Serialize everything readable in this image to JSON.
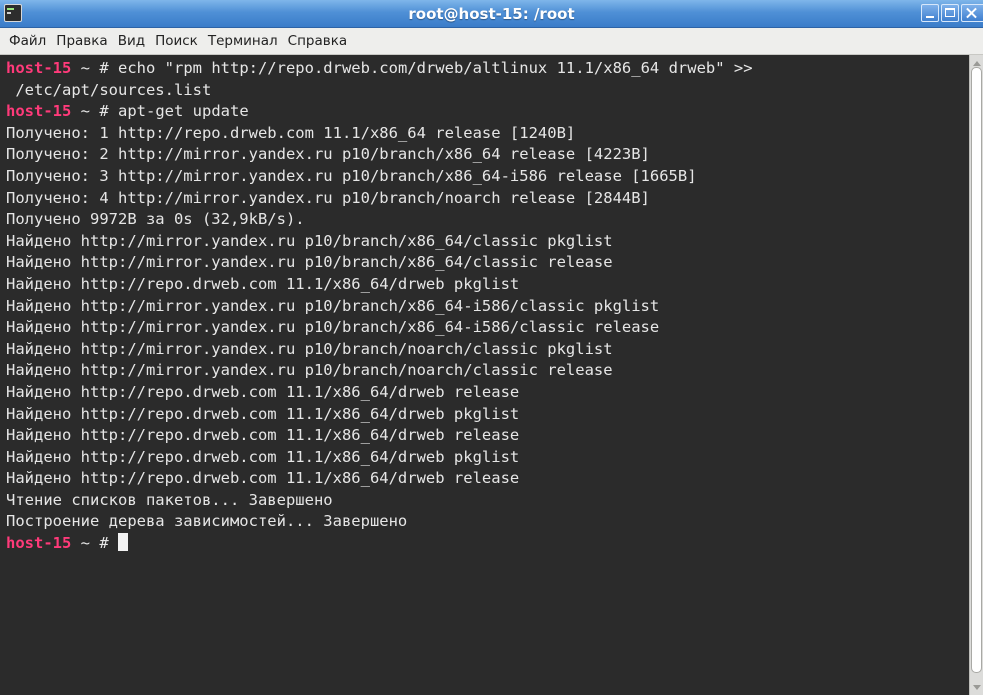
{
  "window": {
    "title": "root@host-15: /root",
    "icon": "terminal-icon"
  },
  "menu": [
    "Файл",
    "Правка",
    "Вид",
    "Поиск",
    "Терминал",
    "Справка"
  ],
  "prompt": {
    "host": "host-15",
    "suffix": " ~ # "
  },
  "terminal": {
    "cmd1": "echo \"rpm http://repo.drweb.com/drweb/altlinux 11.1/x86_64 drweb\" >>",
    "cmd1_cont": " /etc/apt/sources.list",
    "cmd2": "apt-get update",
    "output": [
      "Получено: 1 http://repo.drweb.com 11.1/x86_64 release [1240B]",
      "Получено: 2 http://mirror.yandex.ru p10/branch/x86_64 release [4223B]",
      "Получено: 3 http://mirror.yandex.ru p10/branch/x86_64-i586 release [1665B]",
      "Получено: 4 http://mirror.yandex.ru p10/branch/noarch release [2844B]",
      "Получено 9972B за 0s (32,9kB/s).",
      "Найдено http://mirror.yandex.ru p10/branch/x86_64/classic pkglist",
      "Найдено http://mirror.yandex.ru p10/branch/x86_64/classic release",
      "Найдено http://repo.drweb.com 11.1/x86_64/drweb pkglist",
      "Найдено http://mirror.yandex.ru p10/branch/x86_64-i586/classic pkglist",
      "Найдено http://mirror.yandex.ru p10/branch/x86_64-i586/classic release",
      "Найдено http://mirror.yandex.ru p10/branch/noarch/classic pkglist",
      "Найдено http://mirror.yandex.ru p10/branch/noarch/classic release",
      "Найдено http://repo.drweb.com 11.1/x86_64/drweb release",
      "Найдено http://repo.drweb.com 11.1/x86_64/drweb pkglist",
      "Найдено http://repo.drweb.com 11.1/x86_64/drweb release",
      "Найдено http://repo.drweb.com 11.1/x86_64/drweb pkglist",
      "Найдено http://repo.drweb.com 11.1/x86_64/drweb release",
      "Чтение списков пакетов... Завершено",
      "Построение дерева зависимостей... Завершено"
    ]
  },
  "colors": {
    "prompt_host": "#ff3a7a",
    "terminal_bg": "#2b2b2b",
    "terminal_fg": "#e6e6e6",
    "titlebar": "#4f90d6"
  }
}
